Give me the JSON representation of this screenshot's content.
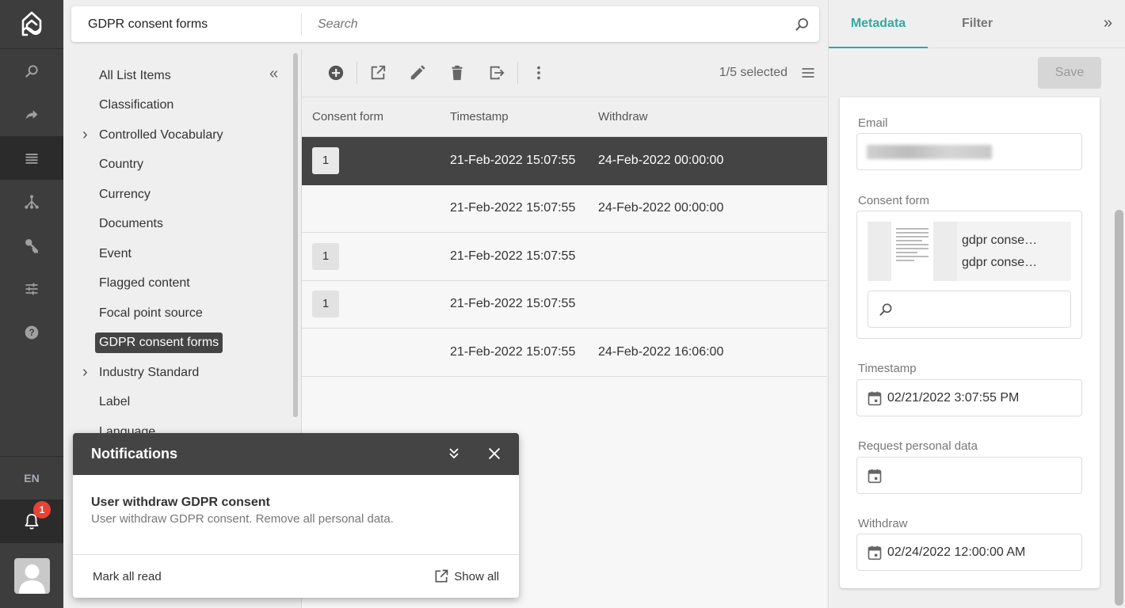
{
  "rail": {
    "items": [
      {
        "icon": "search-icon"
      },
      {
        "icon": "share-icon"
      },
      {
        "icon": "list-icon",
        "active": true
      },
      {
        "icon": "hierarchy-icon"
      },
      {
        "icon": "key-icon"
      },
      {
        "icon": "sliders-icon"
      },
      {
        "icon": "help-icon"
      }
    ],
    "language": "EN",
    "notification_count": "1"
  },
  "topbar": {
    "title": "GDPR consent forms",
    "search_placeholder": "Search"
  },
  "tree": {
    "items": [
      {
        "label": "All List Items",
        "expandable": false
      },
      {
        "label": "Classification",
        "expandable": false
      },
      {
        "label": "Controlled Vocabulary",
        "expandable": true
      },
      {
        "label": "Country",
        "expandable": false
      },
      {
        "label": "Currency",
        "expandable": false
      },
      {
        "label": "Documents",
        "expandable": false
      },
      {
        "label": "Event",
        "expandable": false
      },
      {
        "label": "Flagged content",
        "expandable": false
      },
      {
        "label": "Focal point source",
        "expandable": false
      },
      {
        "label": "GDPR consent forms",
        "expandable": false,
        "selected": true
      },
      {
        "label": "Industry Standard",
        "expandable": true
      },
      {
        "label": "Label",
        "expandable": false
      },
      {
        "label": "Language",
        "expandable": false
      }
    ]
  },
  "toolbar": {
    "selection_count": "1/5 selected"
  },
  "grid": {
    "columns": [
      "Consent form",
      "Timestamp",
      "Withdraw"
    ],
    "rows": [
      {
        "consent_form": "1",
        "timestamp": "21-Feb-2022 15:07:55",
        "withdraw": "24-Feb-2022 00:00:00",
        "selected": true
      },
      {
        "consent_form": "",
        "timestamp": "21-Feb-2022 15:07:55",
        "withdraw": "24-Feb-2022 00:00:00"
      },
      {
        "consent_form": "1",
        "timestamp": "21-Feb-2022 15:07:55",
        "withdraw": ""
      },
      {
        "consent_form": "1",
        "timestamp": "21-Feb-2022 15:07:55",
        "withdraw": ""
      },
      {
        "consent_form": "",
        "timestamp": "21-Feb-2022 15:07:55",
        "withdraw": "24-Feb-2022 16:06:00"
      }
    ]
  },
  "rpanel": {
    "tabs": [
      {
        "label": "Metadata",
        "active": true
      },
      {
        "label": "Filter",
        "active": false
      }
    ],
    "save_label": "Save",
    "accent": "#35a9a4",
    "fields": {
      "email_label": "Email",
      "consent_label": "Consent form",
      "consent_assets": [
        "gdpr conse…",
        "gdpr conse…"
      ],
      "timestamp_label": "Timestamp",
      "timestamp_value": "02/21/2022 3:07:55 PM",
      "request_label": "Request personal data",
      "request_value": "",
      "withdraw_label": "Withdraw",
      "withdraw_value": "02/24/2022 12:00:00 AM"
    }
  },
  "notifications": {
    "title": "Notifications",
    "item_title": "User withdraw GDPR consent",
    "item_text": "User withdraw GDPR consent. Remove all personal data.",
    "mark_all_read": "Mark all read",
    "show_all": "Show all"
  }
}
